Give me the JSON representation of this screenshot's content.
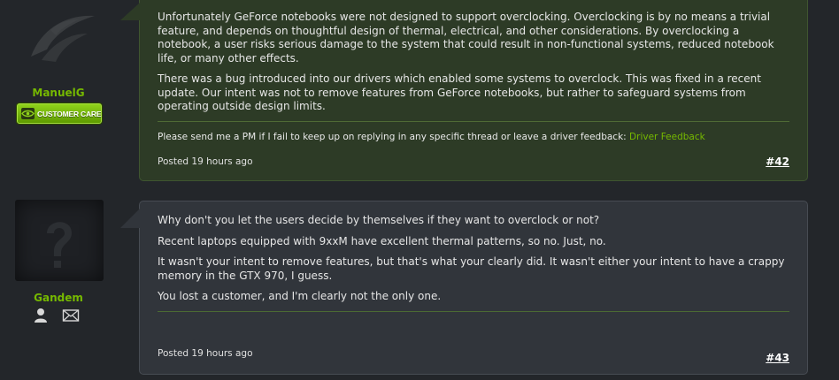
{
  "posts": [
    {
      "username": "ManuelG",
      "badge": "CUSTOMER CARE",
      "paragraphs": [
        "Unfortunately GeForce notebooks were not designed to support overclocking. Overclocking is by no means a trivial feature, and depends on thoughtful design of thermal, electrical, and other considerations. By overclocking a notebook, a user risks serious damage to the system that could result in non-functional systems, reduced notebook life, or many other effects.",
        "There was a bug introduced into our drivers which enabled some systems to overclock. This was fixed in a recent update. Our intent was not to remove features from GeForce notebooks, but rather to safeguard systems from operating outside design limits."
      ],
      "signature_text": "Please send me a PM if I fail to keep up on replying in any specific thread or leave a driver feedback: ",
      "signature_link": "Driver Feedback",
      "posted": "Posted 19 hours ago",
      "post_number": "#42"
    },
    {
      "username": "Gandem",
      "paragraphs": [
        "Why don't you let the users decide by themselves if they want to overclock or not?",
        "Recent laptops equipped with 9xxM have excellent thermal patterns, so no. Just, no.",
        "It wasn't your intent to remove features, but that's what your clearly did. It wasn't either your intent to have a crappy memory in the GTX 970, I guess.",
        "You lost a customer, and I'm clearly not the only one."
      ],
      "posted": "Posted 19 hours ago",
      "post_number": "#43"
    }
  ],
  "icons": {
    "avatar1": "nvidia-claw-logo",
    "avatar2": "question-mark-avatar",
    "profile": "person-icon",
    "message": "envelope-icon"
  },
  "colors": {
    "accent": "#76b900",
    "background": "#23262a",
    "staff_post_bg": "#2d3b26",
    "post_bg": "#31353b"
  }
}
